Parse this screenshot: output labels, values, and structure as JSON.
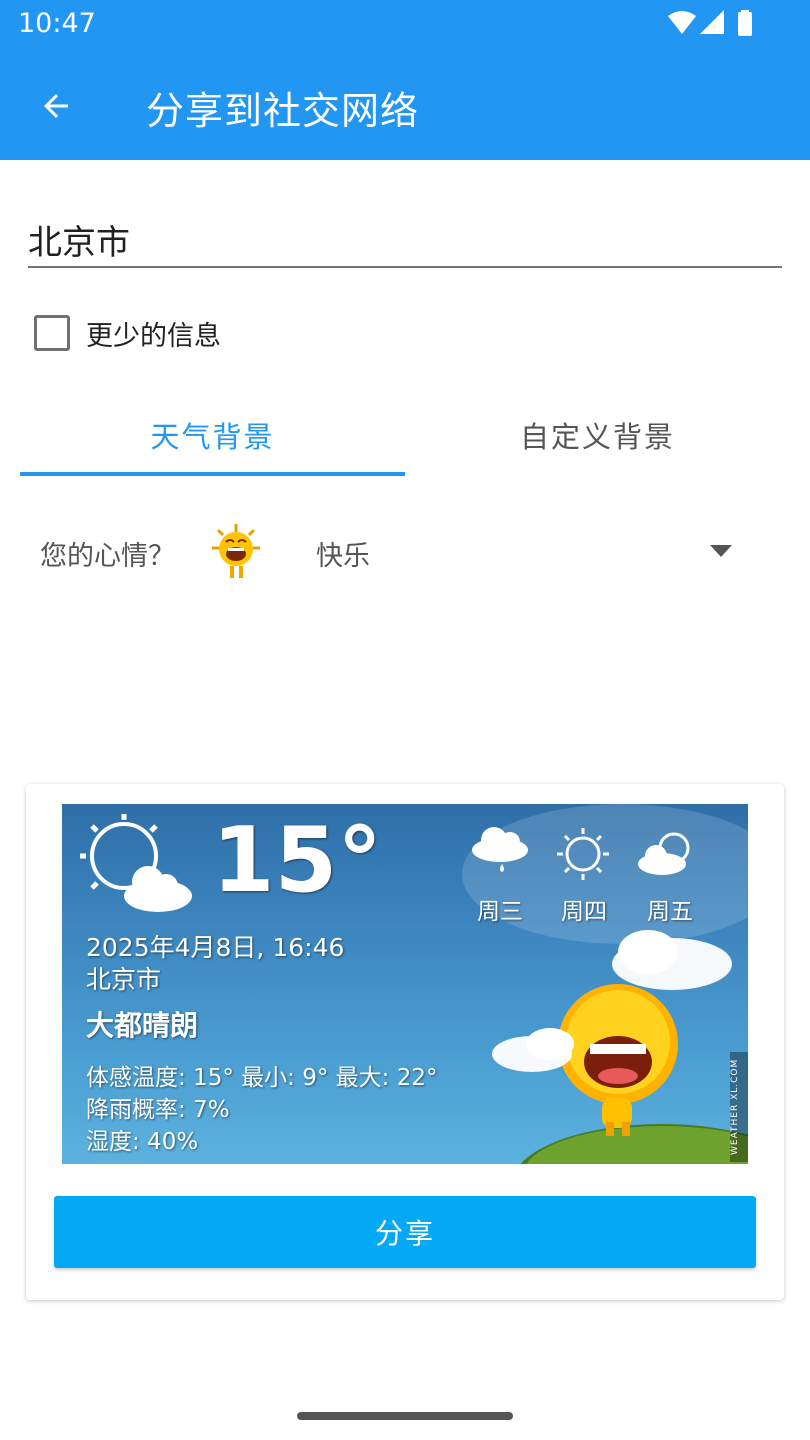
{
  "status_bar": {
    "time": "10:47"
  },
  "app_bar": {
    "title": "分享到社交网络"
  },
  "location": {
    "value": "北京市"
  },
  "less_info": {
    "label": "更少的信息",
    "checked": false
  },
  "tabs": [
    {
      "label": "天气背景",
      "selected": true
    },
    {
      "label": "自定义背景",
      "selected": false
    }
  ],
  "mood": {
    "label": "您的心情？",
    "value": "快乐"
  },
  "weather_card": {
    "temperature": "15°",
    "datetime": "2025年4月8日, 16:46",
    "city": "北京市",
    "condition": "大都晴朗",
    "feels_like": "体感温度: 15° 最小: 9° 最大: 22°",
    "rain_chance": "降雨概率: 7%",
    "humidity": "湿度: 40%",
    "forecast": [
      {
        "day": "周三",
        "icon": "rain-cloud-icon"
      },
      {
        "day": "周四",
        "icon": "sun-icon"
      },
      {
        "day": "周五",
        "icon": "partly-cloudy-icon"
      }
    ],
    "watermark": "WEATHER XL.COM"
  },
  "share_button": {
    "label": "分享"
  },
  "colors": {
    "primary": "#2196f3",
    "share_button": "#03a9f4"
  }
}
